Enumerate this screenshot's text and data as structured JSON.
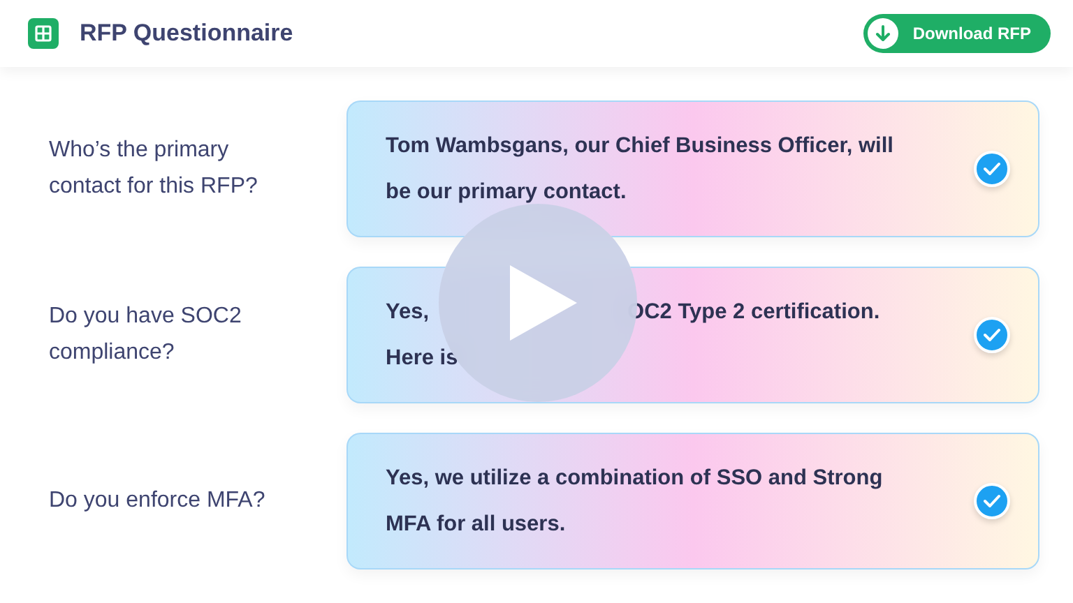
{
  "header": {
    "title": "RFP Questionnaire",
    "download_button": "Download RFP"
  },
  "items": [
    {
      "question": "Who’s the primary contact for this RFP?",
      "answer_lines": [
        [
          "Tom Wambsgans, our Chief Business Officer, will"
        ],
        [
          "be our primary contact."
        ]
      ],
      "checked": true
    },
    {
      "question": "Do you have SOC2 compliance?",
      "answer_lines": [
        [
          "Yes,",
          "OC2 Type 2 certification."
        ],
        [
          "Here is"
        ]
      ],
      "checked": true
    },
    {
      "question": "Do you enforce MFA?",
      "answer_lines": [
        [
          "Yes, we utilize a combination of SSO and Strong"
        ],
        [
          "MFA for all users."
        ]
      ],
      "checked": true
    }
  ]
}
